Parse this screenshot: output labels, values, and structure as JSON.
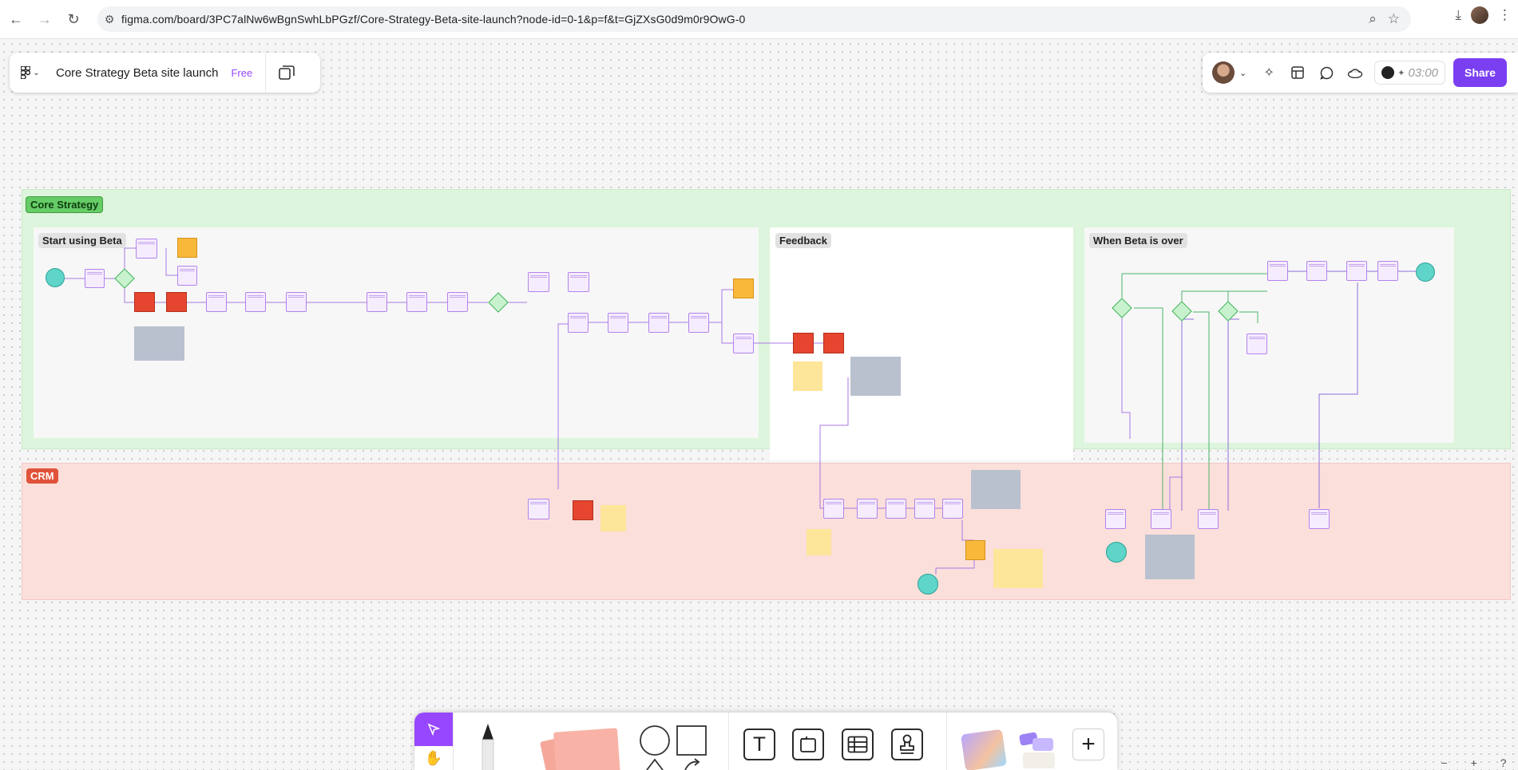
{
  "browser": {
    "url": "figma.com/board/3PC7alNw6wBgnSwhLbPGzf/Core-Strategy-Beta-site-launch?node-id=0-1&p=f&t=GjZXsG0d9m0r9OwG-0",
    "back_icon": "back-arrow-icon",
    "forward_icon": "forward-arrow-icon",
    "reload_icon": "reload-icon"
  },
  "file": {
    "title": "Core Strategy Beta site launch",
    "plan": "Free"
  },
  "toolbar_right": {
    "timer": "03:00",
    "share_label": "Share"
  },
  "canvas": {
    "sections": [
      {
        "name": "Core Strategy"
      },
      {
        "name": "CRM"
      }
    ],
    "subsections": [
      {
        "name": "Start using Beta"
      },
      {
        "name": "Feedback"
      },
      {
        "name": "When Beta is over"
      }
    ]
  },
  "bottom_toolbar": {
    "tools": [
      "select",
      "hand",
      "pen",
      "sticky-note",
      "shapes",
      "text",
      "section",
      "table",
      "stamp",
      "templates",
      "more"
    ],
    "text_tool_glyph": "T",
    "add_glyph": "+"
  },
  "zoom": {
    "minus": "−",
    "plus": "+",
    "help": "?"
  },
  "colors": {
    "accent": "#9747ff",
    "share": "#7b3ff2",
    "core_section": "#dcf5dc",
    "crm_section": "#fbdfda"
  }
}
